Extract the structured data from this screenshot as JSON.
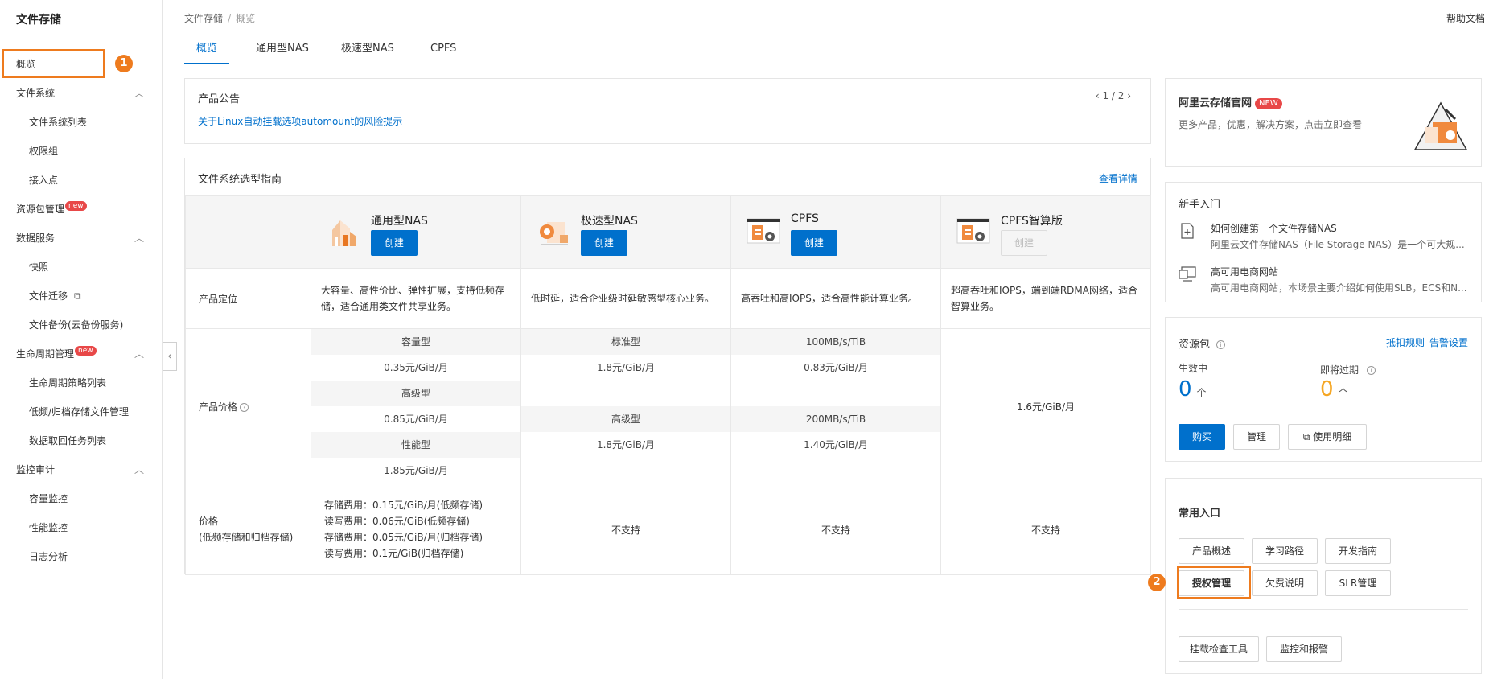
{
  "sidebar": {
    "title": "文件存储",
    "items": [
      {
        "label": "概览",
        "type": "top",
        "active": true
      },
      {
        "label": "文件系统",
        "type": "group",
        "chevron": "up"
      },
      {
        "label": "文件系统列表",
        "type": "sub"
      },
      {
        "label": "权限组",
        "type": "sub"
      },
      {
        "label": "接入点",
        "type": "sub"
      },
      {
        "label": "资源包管理",
        "type": "top",
        "badge": "new"
      },
      {
        "label": "数据服务",
        "type": "group",
        "chevron": "up"
      },
      {
        "label": "快照",
        "type": "sub"
      },
      {
        "label": "文件迁移",
        "type": "sub",
        "icon": "external-link-icon"
      },
      {
        "label": "文件备份(云备份服务)",
        "type": "sub"
      },
      {
        "label": "生命周期管理",
        "type": "group",
        "badge": "new",
        "chevron": "up"
      },
      {
        "label": "生命周期策略列表",
        "type": "sub"
      },
      {
        "label": "低频/归档存储文件管理",
        "type": "sub"
      },
      {
        "label": "数据取回任务列表",
        "type": "sub"
      },
      {
        "label": "监控审计",
        "type": "group",
        "chevron": "up"
      },
      {
        "label": "容量监控",
        "type": "sub"
      },
      {
        "label": "性能监控",
        "type": "sub"
      },
      {
        "label": "日志分析",
        "type": "sub"
      }
    ],
    "collapse_icon": "chevron-left-icon"
  },
  "markers": {
    "one": "1",
    "two": "2"
  },
  "breadcrumb": {
    "root": "文件存储",
    "sep": "/",
    "current": "概览"
  },
  "help": "帮助文档",
  "tabs": [
    "概览",
    "通用型NAS",
    "极速型NAS",
    "CPFS"
  ],
  "notice": {
    "label": "产品公告",
    "link": "关于Linux自动挂载选项automount的风险提示",
    "pager": "‹ 1 / 2 ›"
  },
  "guide": {
    "title": "文件系统选型指南",
    "more": "查看详情",
    "products": [
      {
        "name": "通用型NAS",
        "button": "创建",
        "disabled": false,
        "icon": "general-nas-icon"
      },
      {
        "name": "极速型NAS",
        "button": "创建",
        "disabled": false,
        "icon": "extreme-nas-icon"
      },
      {
        "name": "CPFS",
        "button": "创建",
        "disabled": false,
        "icon": "cpfs-icon"
      },
      {
        "name": "CPFS智算版",
        "button": "创建",
        "disabled": true,
        "icon": "cpfs-ai-icon"
      }
    ],
    "row_position": {
      "label": "产品定位",
      "values": [
        "大容量、高性价比、弹性扩展，支持低频存储，适合通用类文件共享业务。",
        "低时延，适合企业级时延敏感型核心业务。",
        "高吞吐和高IOPS，适合高性能计算业务。",
        "超高吞吐和IOPS，端到端RDMA网络，适合智算业务。"
      ]
    },
    "row_price": {
      "label": "产品价格",
      "general": [
        "容量型",
        "0.35元/GiB/月",
        "高级型",
        "0.85元/GiB/月",
        "性能型",
        "1.85元/GiB/月"
      ],
      "extreme": [
        "标准型",
        "1.8元/GiB/月",
        "",
        "高级型",
        "1.8元/GiB/月",
        ""
      ],
      "cpfs": [
        "100MB/s/TiB",
        "0.83元/GiB/月",
        "",
        "200MB/s/TiB",
        "1.40元/GiB/月",
        ""
      ],
      "cpfs_ai": "1.6元/GiB/月"
    },
    "row_archive": {
      "label_line1": "价格",
      "label_line2": "(低频存储和归档存储)",
      "general": [
        "存储费用：0.15元/GiB/月(低频存储)",
        "读写费用：0.06元/GiB(低频存储)",
        "存储费用：0.05元/GiB/月(归档存储)",
        "读写费用：0.1元/GiB(归档存储)"
      ],
      "extreme": "不支持",
      "cpfs": "不支持",
      "cpfs_ai": "不支持"
    }
  },
  "promo": {
    "title": "阿里云存储官网",
    "badge": "NEW",
    "desc": "更多产品，优惠，解决方案，点击立即查看"
  },
  "starter": {
    "title": "新手入门",
    "items": [
      {
        "title": "如何创建第一个文件存储NAS",
        "desc": "阿里云文件存储NAS（File Storage NAS）是一个可大规...",
        "icon": "doc-plus-icon"
      },
      {
        "title": "高可用电商网站",
        "desc": "高可用电商网站，本场景主要介绍如何使用SLB，ECS和N...",
        "icon": "monitor-icon"
      }
    ]
  },
  "resource": {
    "title": "资源包",
    "link1": "抵扣规则",
    "link2": "告警设置",
    "active_label": "生效中",
    "active_value": "0",
    "expiring_label": "即将过期",
    "expiring_value": "0",
    "unit": "个",
    "buy": "购买",
    "manage": "管理",
    "detail": "使用明细",
    "colors": {
      "active": "#0070cc",
      "expiring": "#f5a623"
    }
  },
  "common": {
    "title": "常用入口",
    "row1": [
      "产品概述",
      "学习路径",
      "开发指南"
    ],
    "row2": [
      "授权管理",
      "欠费说明",
      "SLR管理"
    ],
    "row3": [
      "挂载检查工具",
      "监控和报警"
    ]
  },
  "colors": {
    "accent": "#0070cc",
    "highlight": "#ee7b1e",
    "badge": "#e84848"
  }
}
